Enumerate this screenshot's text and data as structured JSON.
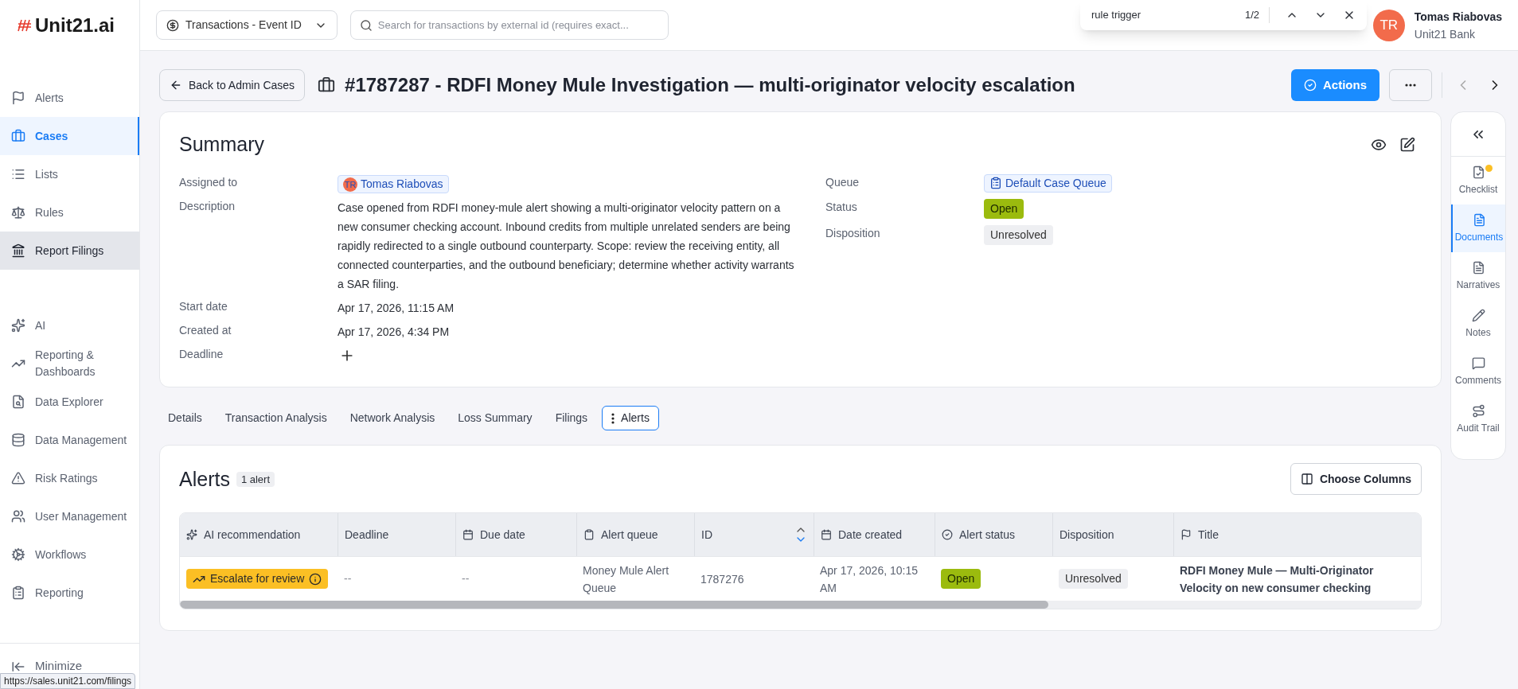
{
  "brand": {
    "name": "Unit21.ai"
  },
  "topbar": {
    "search_type": "Transactions - Event ID",
    "search_placeholder": "Search for transactions by external id (requires exact...",
    "user": {
      "initials": "TR",
      "name": "Tomas Riabovas",
      "org": "Unit21 Bank"
    }
  },
  "find_bar": {
    "query": "rule trigger",
    "count": "1/2"
  },
  "sidebar": {
    "groups": [
      {
        "items": [
          {
            "label": "Alerts",
            "selected": false,
            "highlighted": false
          },
          {
            "label": "Cases",
            "selected": true,
            "highlighted": false
          },
          {
            "label": "Lists",
            "selected": false,
            "highlighted": false
          },
          {
            "label": "Rules",
            "selected": false,
            "highlighted": false
          },
          {
            "label": "Report Filings",
            "selected": false,
            "highlighted": true
          }
        ]
      },
      {
        "items": [
          {
            "label": "AI",
            "selected": false,
            "highlighted": false
          },
          {
            "label": "Reporting & Dashboards",
            "selected": false,
            "highlighted": false
          },
          {
            "label": "Data Explorer",
            "selected": false,
            "highlighted": false
          },
          {
            "label": "Data Management",
            "selected": false,
            "highlighted": false
          },
          {
            "label": "Risk Ratings",
            "selected": false,
            "highlighted": false
          },
          {
            "label": "User Management",
            "selected": false,
            "highlighted": false
          },
          {
            "label": "Workflows",
            "selected": false,
            "highlighted": false
          },
          {
            "label": "Reporting",
            "selected": false,
            "highlighted": false
          }
        ]
      }
    ],
    "minimize": "Minimize"
  },
  "header": {
    "back": "Back to Admin Cases",
    "title": "#1787287 - RDFI Money Mule Investigation — multi-originator velocity escalation",
    "actions": "Actions"
  },
  "summary": {
    "title": "Summary",
    "left": [
      {
        "label": "Assigned to",
        "kind": "person",
        "value": "Tomas Riabovas",
        "initials": "TR"
      },
      {
        "label": "Description",
        "kind": "text",
        "value": "Case opened from RDFI money-mule alert showing a multi-originator velocity pattern on a new consumer checking account. Inbound credits from multiple unrelated senders are being rapidly redirected to a single outbound counterparty. Scope: review the receiving entity, all connected counterparties, and the outbound beneficiary; determine whether activity warrants a SAR filing."
      },
      {
        "label": "Start date",
        "kind": "text",
        "value": "Apr 17, 2026, 11:15 AM"
      },
      {
        "label": "Created at",
        "kind": "text",
        "value": "Apr 17, 2026, 4:34 PM"
      },
      {
        "label": "Deadline",
        "kind": "add"
      }
    ],
    "right": [
      {
        "label": "Queue",
        "kind": "queue",
        "value": "Default Case Queue"
      },
      {
        "label": "Status",
        "kind": "status",
        "value": "Open"
      },
      {
        "label": "Disposition",
        "kind": "tag",
        "value": "Unresolved"
      }
    ]
  },
  "tabs": [
    {
      "label": "Details",
      "selected": false
    },
    {
      "label": "Transaction Analysis",
      "selected": false
    },
    {
      "label": "Network Analysis",
      "selected": false
    },
    {
      "label": "Loss Summary",
      "selected": false
    },
    {
      "label": "Filings",
      "selected": false
    },
    {
      "label": "Alerts",
      "selected": true
    }
  ],
  "alerts": {
    "title": "Alerts",
    "count": "1 alert",
    "choose_columns": "Choose Columns",
    "columns": [
      {
        "label": "AI recommendation"
      },
      {
        "label": "Deadline"
      },
      {
        "label": "Due date"
      },
      {
        "label": "Alert queue"
      },
      {
        "label": "ID",
        "sort_descending": true
      },
      {
        "label": "Date created"
      },
      {
        "label": "Alert status"
      },
      {
        "label": "Disposition"
      },
      {
        "label": "Title"
      }
    ],
    "rows": [
      {
        "cells": [
          {
            "kind": "recommendation",
            "text": "Escalate for review"
          },
          {
            "kind": "muted",
            "text": "--"
          },
          {
            "kind": "muted",
            "text": "--"
          },
          {
            "kind": "text",
            "text": "Money Mule Alert Queue"
          },
          {
            "kind": "text",
            "text": "1787276"
          },
          {
            "kind": "text",
            "text": "Apr 17, 2026, 10:15 AM"
          },
          {
            "kind": "status",
            "text": "Open"
          },
          {
            "kind": "tag",
            "text": "Unresolved"
          },
          {
            "kind": "bold",
            "text": "RDFI Money Mule — Multi-Originator Velocity on new consumer checking"
          }
        ]
      }
    ]
  },
  "right_rail": [
    {
      "label": "Checklist",
      "selected": false,
      "notification": true
    },
    {
      "label": "Documents",
      "selected": true,
      "notification": false
    },
    {
      "label": "Narratives",
      "selected": false,
      "notification": false
    },
    {
      "label": "Notes",
      "selected": false,
      "notification": false
    },
    {
      "label": "Comments",
      "selected": false,
      "notification": false
    },
    {
      "label": "Audit Trail",
      "selected": false,
      "notification": false
    }
  ],
  "status_url": "https://sales.unit21.com/filings"
}
